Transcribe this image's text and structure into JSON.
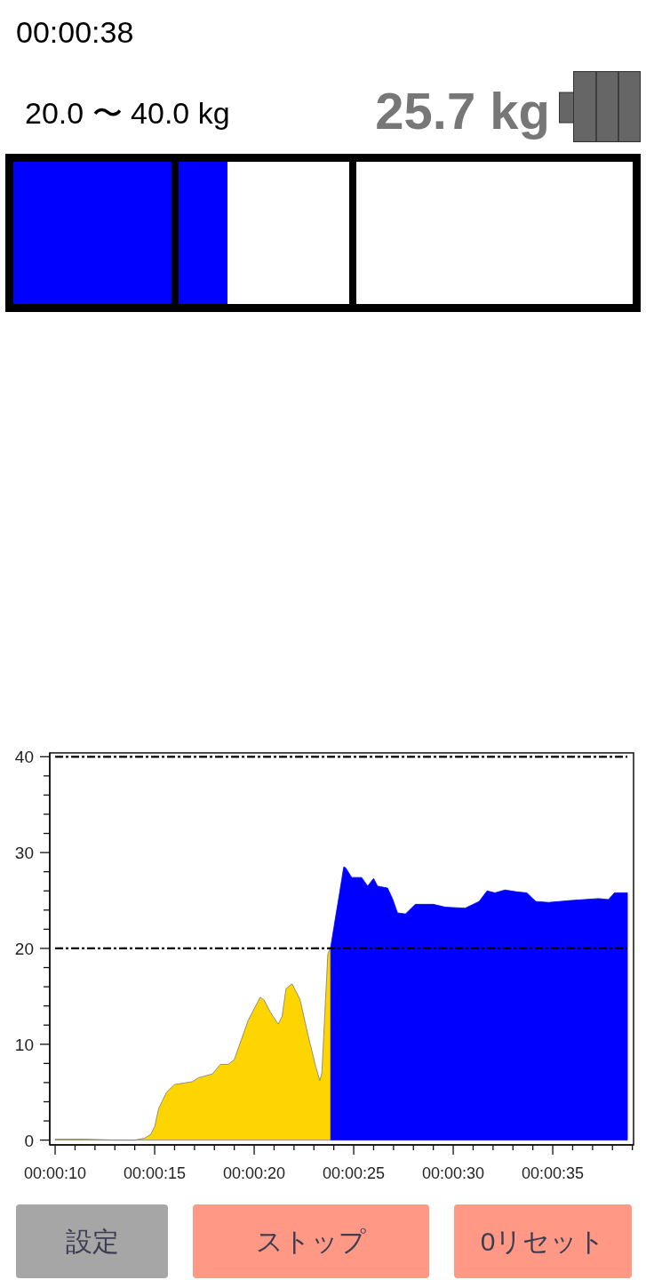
{
  "timer": "00:00:38",
  "range": "20.0 〜 40.0 kg",
  "reading": "25.7 kg",
  "gauge": {
    "segments": [
      {
        "level": 1
      },
      {
        "level": 0.285
      },
      {
        "level": 0
      }
    ]
  },
  "chart": {
    "chart_data": {
      "type": "area",
      "x": [
        10,
        11.5,
        13,
        14,
        14.5,
        14.8,
        15,
        15.2,
        15.6,
        16,
        16.9,
        17.2,
        17.9,
        18.3,
        18.7,
        19,
        19.7,
        20.3,
        20.5,
        20.8,
        21.2,
        21.4,
        21.6,
        21.9,
        22.3,
        22.7,
        23.1,
        23.3,
        23.4,
        23.7,
        23.85,
        24.1,
        24.3,
        24.5,
        24.6,
        24.9,
        25.4,
        25.7,
        26,
        26.2,
        26.7,
        26.95,
        27.2,
        27.6,
        28.1,
        29,
        29.6,
        30.6,
        31.3,
        31.7,
        32.1,
        32.6,
        33.2,
        33.7,
        34.15,
        34.8,
        35.9,
        37.3,
        37.8,
        38.1,
        38.75
      ],
      "series": [
        {
          "color": "#ffd500",
          "values": [
            0.1,
            0.1,
            0,
            0,
            0.2,
            0.6,
            1.4,
            3.3,
            5,
            5.8,
            6.1,
            6.5,
            6.9,
            7.9,
            7.9,
            8.4,
            12.5,
            14.9,
            14.6,
            13.4,
            12.1,
            12.9,
            15.8,
            16.3,
            14.7,
            11,
            7.6,
            6.2,
            7,
            19.4,
            20.2,
            null,
            null,
            null,
            null,
            null,
            null,
            null,
            null,
            null,
            null,
            null,
            null,
            null,
            null,
            null,
            null,
            null,
            null,
            null,
            null,
            null,
            null,
            null,
            null,
            null,
            null,
            null,
            null,
            null,
            null
          ]
        },
        {
          "color": "#0000ff",
          "values": [
            null,
            null,
            null,
            null,
            null,
            null,
            null,
            null,
            null,
            null,
            null,
            null,
            null,
            null,
            null,
            null,
            null,
            null,
            null,
            null,
            null,
            null,
            null,
            null,
            null,
            null,
            null,
            null,
            null,
            null,
            20.2,
            23.4,
            25.9,
            28.5,
            28.4,
            27.4,
            27.4,
            26.5,
            27.3,
            26.5,
            26.3,
            25.2,
            23.7,
            23.6,
            24.6,
            24.6,
            24.3,
            24.2,
            24.9,
            26,
            25.8,
            26.1,
            25.9,
            25.8,
            24.9,
            24.8,
            25,
            25.2,
            25.1,
            25.8,
            25.8
          ]
        }
      ],
      "xlim": [
        9.73,
        39.06
      ],
      "ylim": [
        -0.5,
        40.4
      ],
      "xticks": [
        {
          "value": 10,
          "label": "00:00:10"
        },
        {
          "value": 15,
          "label": "00:00:15"
        },
        {
          "value": 20,
          "label": "00:00:20"
        },
        {
          "value": 25,
          "label": "00:00:25"
        },
        {
          "value": 30,
          "label": "00:00:30"
        },
        {
          "value": 35,
          "label": "00:00:35"
        }
      ],
      "yticks": [
        0,
        10,
        20,
        30,
        40
      ],
      "ref_lines": [
        {
          "axis": "y",
          "value": 40
        },
        {
          "axis": "y",
          "value": 20
        }
      ]
    }
  },
  "buttons": [
    {
      "label": "設定",
      "color": "#a6a6a6"
    },
    {
      "label": "ストップ",
      "color": "#ff9985"
    },
    {
      "label": "0リセット",
      "color": "#ff9985"
    }
  ]
}
